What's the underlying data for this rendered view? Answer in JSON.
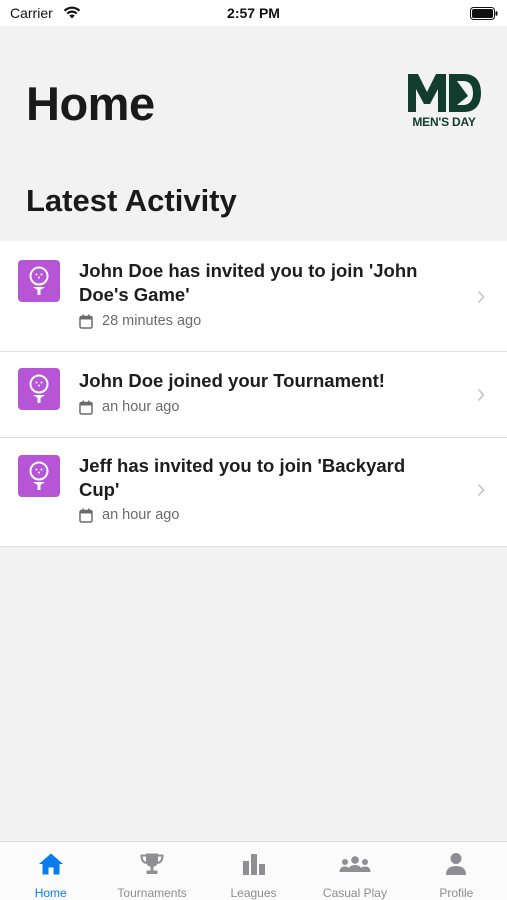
{
  "status_bar": {
    "carrier": "Carrier",
    "time": "2:57 PM"
  },
  "header": {
    "title": "Home",
    "logo": {
      "mark": "MD",
      "text": "MEN'S DAY",
      "color": "#123d2e"
    }
  },
  "section": {
    "title": "Latest Activity"
  },
  "activity": [
    {
      "title": "John Doe has invited you to join 'John Doe's Game'",
      "time": "28 minutes ago",
      "icon": "golf-ball-on-tee-icon"
    },
    {
      "title": "John Doe joined your Tournament!",
      "time": "an hour ago",
      "icon": "golf-ball-on-tee-icon"
    },
    {
      "title": "Jeff has invited you to join 'Backyard Cup'",
      "time": "an hour ago",
      "icon": "golf-ball-on-tee-icon"
    }
  ],
  "tabs": [
    {
      "label": "Home",
      "icon": "home-icon",
      "active": true
    },
    {
      "label": "Tournaments",
      "icon": "trophy-icon",
      "active": false
    },
    {
      "label": "Leagues",
      "icon": "bar-chart-icon",
      "active": false
    },
    {
      "label": "Casual Play",
      "icon": "group-icon",
      "active": false
    },
    {
      "label": "Profile",
      "icon": "person-icon",
      "active": false
    }
  ],
  "colors": {
    "accent": "#0a7cf0",
    "icon_tile": "#b656d6",
    "background": "#f2f2f2",
    "inactive_tab": "#8e8e93"
  }
}
